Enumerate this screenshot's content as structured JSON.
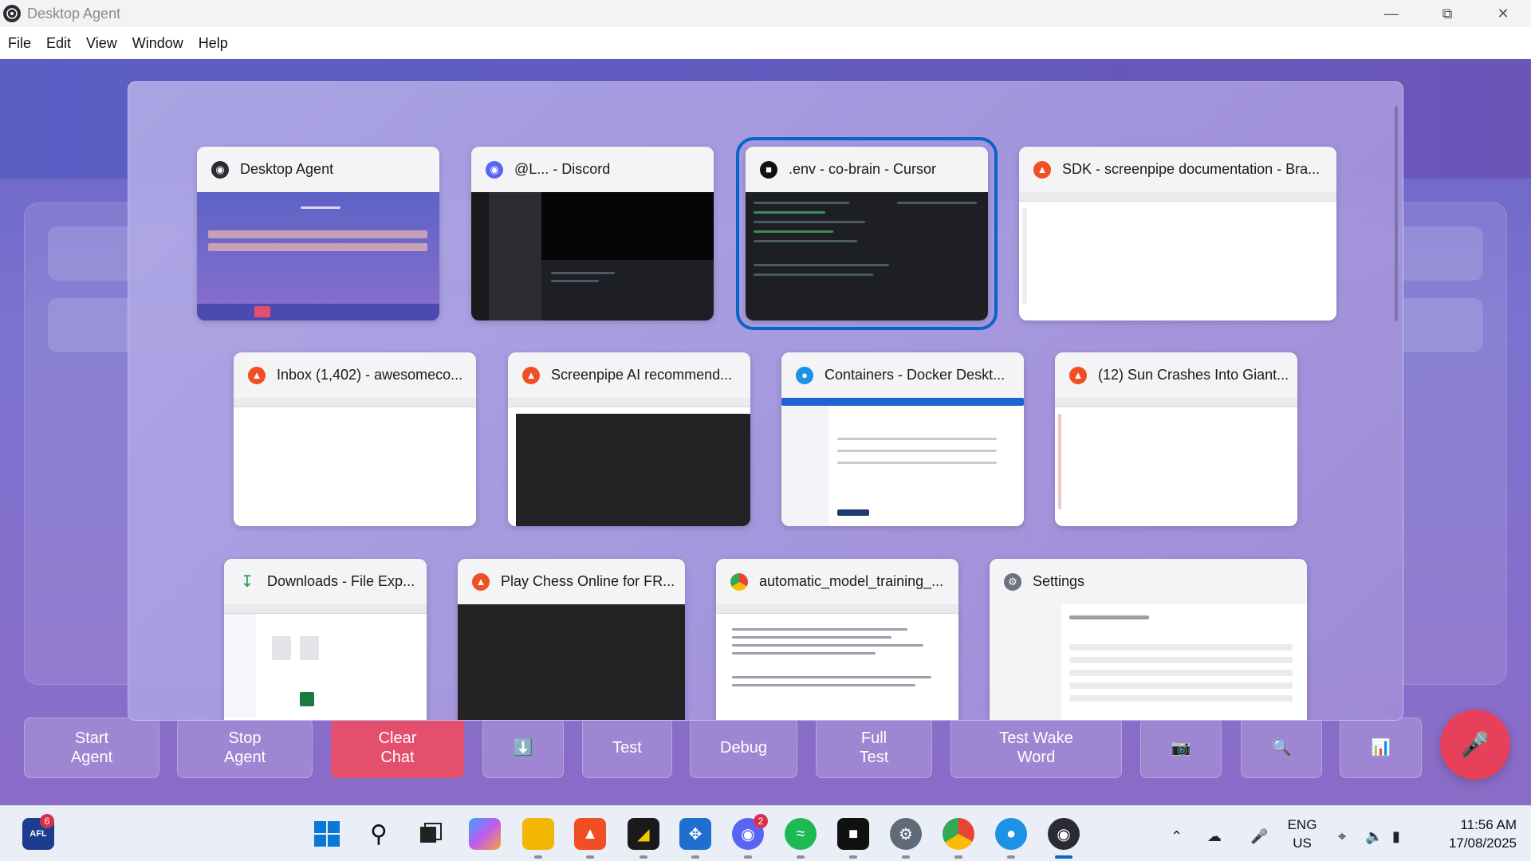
{
  "window": {
    "title": "Desktop Agent"
  },
  "menu": [
    "File",
    "Edit",
    "View",
    "Window",
    "Help"
  ],
  "task_view": {
    "windows": [
      {
        "title": "Desktop Agent",
        "app": "desktop-agent",
        "icon_color": "#2b2b33",
        "selected": false
      },
      {
        "title": "@L... - Discord",
        "app": "discord",
        "icon_color": "#5865f2",
        "selected": false
      },
      {
        "title": ".env - co-brain - Cursor",
        "app": "cursor",
        "icon_color": "#111111",
        "selected": true
      },
      {
        "title": "SDK - screenpipe documentation - Bra...",
        "app": "brave",
        "icon_color": "#f04e23",
        "selected": false
      },
      {
        "title": "Inbox (1,402) - awesomeco...",
        "app": "brave",
        "icon_color": "#f04e23",
        "selected": false
      },
      {
        "title": "Screenpipe AI recommend...",
        "app": "brave",
        "icon_color": "#f04e23",
        "selected": false
      },
      {
        "title": "Containers - Docker Deskt...",
        "app": "docker",
        "icon_color": "#1d91e6",
        "selected": false
      },
      {
        "title": "(12) Sun Crashes Into Giant...",
        "app": "brave",
        "icon_color": "#f04e23",
        "selected": false
      },
      {
        "title": "Downloads - File Exp...",
        "app": "file-explorer",
        "icon_color": "#1fa04a",
        "selected": false
      },
      {
        "title": "Play Chess Online for FR...",
        "app": "brave",
        "icon_color": "#f04e23",
        "selected": false
      },
      {
        "title": "automatic_model_training_...",
        "app": "chrome",
        "icon_color": "#34a853",
        "selected": false
      },
      {
        "title": "Settings",
        "app": "settings",
        "icon_color": "#6b7280",
        "selected": false
      }
    ]
  },
  "controls": {
    "start_agent": "Start\nAgent",
    "stop_agent": "Stop\nAgent",
    "clear_chat": "Clear\nChat",
    "download_icon": "⬇️",
    "test": "Test",
    "debug": "Debug",
    "full_test": "Full\nTest",
    "test_wake_word": "Test Wake\nWord",
    "camera_icon": "📷",
    "search_icon": "🔍",
    "stats_icon": "📊",
    "mic_icon": "🎤"
  },
  "taskbar": {
    "widget_badge": "6",
    "discord_badge": "2",
    "language": "ENG",
    "region": "US",
    "time": "11:56 AM",
    "date": "17/08/2025"
  }
}
